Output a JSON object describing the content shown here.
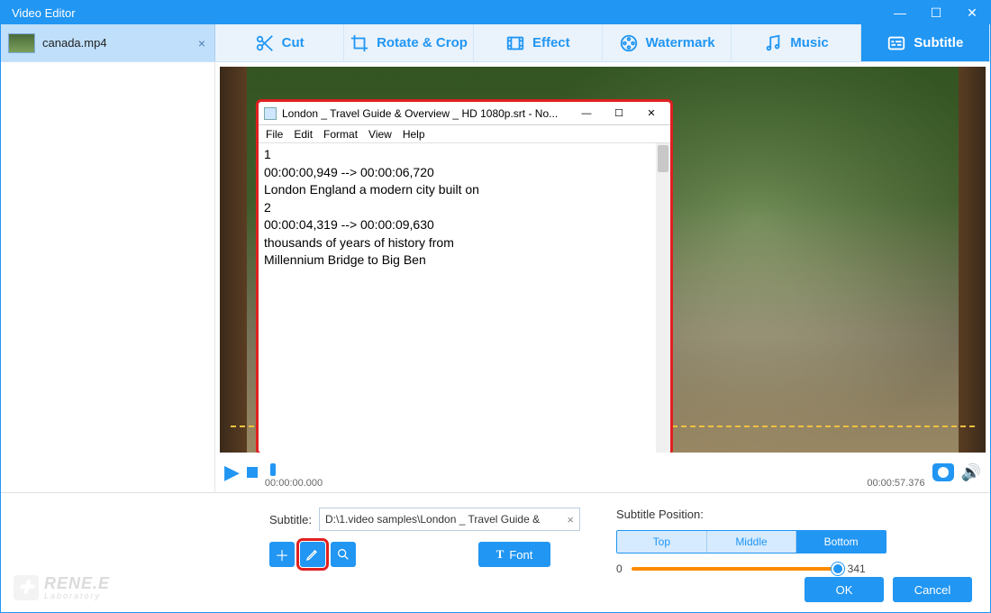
{
  "window": {
    "title": "Video Editor"
  },
  "file_tab": {
    "name": "canada.mp4"
  },
  "tools": {
    "items": [
      {
        "id": "cut",
        "label": "Cut"
      },
      {
        "id": "rotate",
        "label": "Rotate & Crop"
      },
      {
        "id": "effect",
        "label": "Effect"
      },
      {
        "id": "watermark",
        "label": "Watermark"
      },
      {
        "id": "music",
        "label": "Music"
      },
      {
        "id": "subtitle",
        "label": "Subtitle"
      }
    ],
    "active": "subtitle"
  },
  "preview": {
    "subtitle_caption": "Subtitle",
    "time_start": "00:00:00.000",
    "time_end": "00:00:57.376"
  },
  "notepad": {
    "title": "London _ Travel Guide & Overview _ HD 1080p.srt - No...",
    "menu": [
      "File",
      "Edit",
      "Format",
      "View",
      "Help"
    ],
    "content": "1\n00:00:00,949 --> 00:00:06,720\nLondon England a modern city built on\n2\n00:00:04,319 --> 00:00:09,630\nthousands of years of history from\nMillennium Bridge to Big Ben"
  },
  "subtitle_panel": {
    "label": "Subtitle:",
    "path": "D:\\1.video samples\\London _ Travel Guide & ",
    "font_label": "Font",
    "position_label": "Subtitle Position:",
    "position_options": [
      "Top",
      "Middle",
      "Bottom"
    ],
    "position_selected": "Bottom",
    "slider_min": "0",
    "slider_max": "341"
  },
  "buttons": {
    "ok": "OK",
    "cancel": "Cancel"
  },
  "logo": {
    "brand": "RENE.E",
    "sub": "Laboratory"
  }
}
